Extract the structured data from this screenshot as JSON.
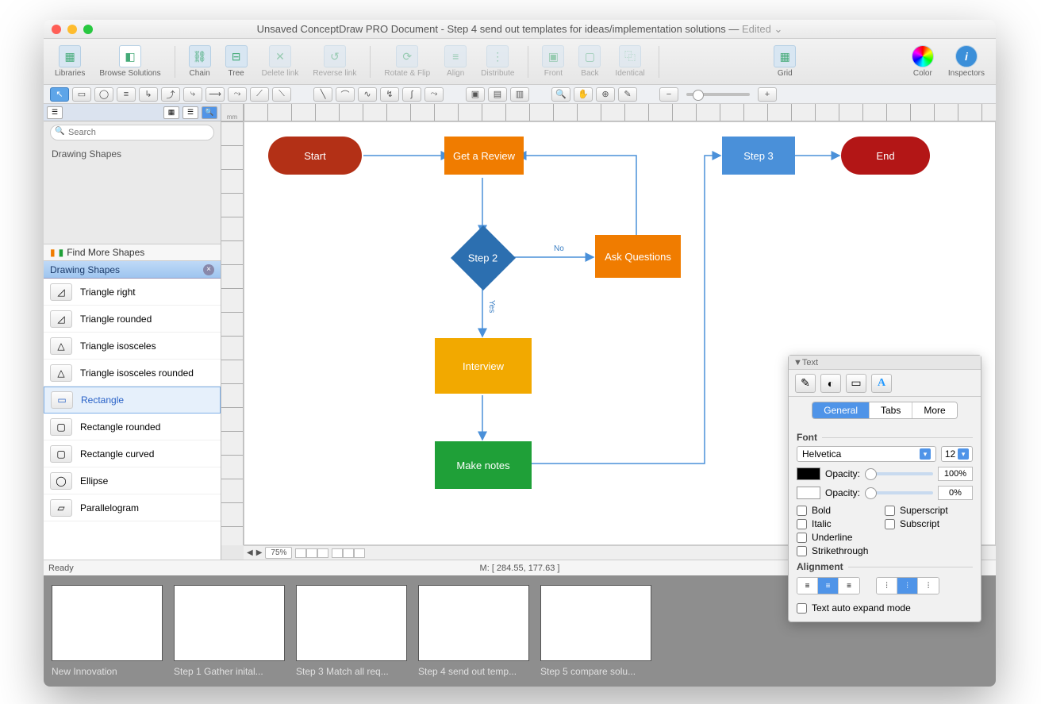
{
  "title": {
    "prefix": "Unsaved ConceptDraw PRO Document - ",
    "doc": "Step 4 send out templates for ideas/implementation solutions",
    "suffix": " — ",
    "edited": "Edited"
  },
  "toolbar": {
    "libraries": "Libraries",
    "browse": "Browse Solutions",
    "chain": "Chain",
    "tree": "Tree",
    "delete_link": "Delete link",
    "reverse_link": "Reverse link",
    "rotate_flip": "Rotate & Flip",
    "align": "Align",
    "distribute": "Distribute",
    "front": "Front",
    "back": "Back",
    "identical": "Identical",
    "grid": "Grid",
    "color": "Color",
    "inspectors": "Inspectors"
  },
  "left_panel": {
    "search_placeholder": "Search",
    "section": "Drawing Shapes",
    "find_more": "Find More Shapes",
    "category": "Drawing Shapes",
    "shapes": [
      "Triangle right",
      "Triangle rounded",
      "Triangle isosceles",
      "Triangle isosceles rounded",
      "Rectangle",
      "Rectangle rounded",
      "Rectangle curved",
      "Ellipse",
      "Parallelogram"
    ],
    "selected_index": 4
  },
  "canvas": {
    "ruler_unit": "mm",
    "zoom": "75%",
    "status_ready": "Ready",
    "status_coords": "M: [ 284.55, 177.63 ]"
  },
  "flow": {
    "nodes": {
      "start": {
        "label": "Start",
        "color": "#b33016"
      },
      "review": {
        "label": "Get a Review",
        "color": "#f07c00"
      },
      "step2": {
        "label": "Step 2",
        "color": "#2c6fb0"
      },
      "ask": {
        "label": "Ask Questions",
        "color": "#f07c00"
      },
      "interview": {
        "label": "Interview",
        "color": "#f2a900"
      },
      "notes": {
        "label": "Make notes",
        "color": "#1fa038"
      },
      "step3": {
        "label": "Step 3",
        "color": "#4a90d9"
      },
      "end": {
        "label": "End",
        "color": "#b31616"
      }
    },
    "edge_labels": {
      "no": "No",
      "yes": "Yes"
    }
  },
  "inspector": {
    "title": "Text",
    "tabs": {
      "general": "General",
      "tabs": "Tabs",
      "more": "More"
    },
    "font_label": "Font",
    "font_name": "Helvetica",
    "font_size": "12",
    "opacity_label": "Opacity:",
    "opacity1": "100%",
    "opacity2": "0%",
    "styles": {
      "bold": "Bold",
      "italic": "Italic",
      "underline": "Underline",
      "strike": "Strikethrough",
      "super": "Superscript",
      "sub": "Subscript"
    },
    "alignment_label": "Alignment",
    "auto_expand": "Text auto expand mode"
  },
  "thumbs": [
    "New Innovation",
    "Step 1 Gather inital...",
    "Step 3 Match all req...",
    "Step 4 send out temp...",
    "Step 5 compare solu..."
  ]
}
